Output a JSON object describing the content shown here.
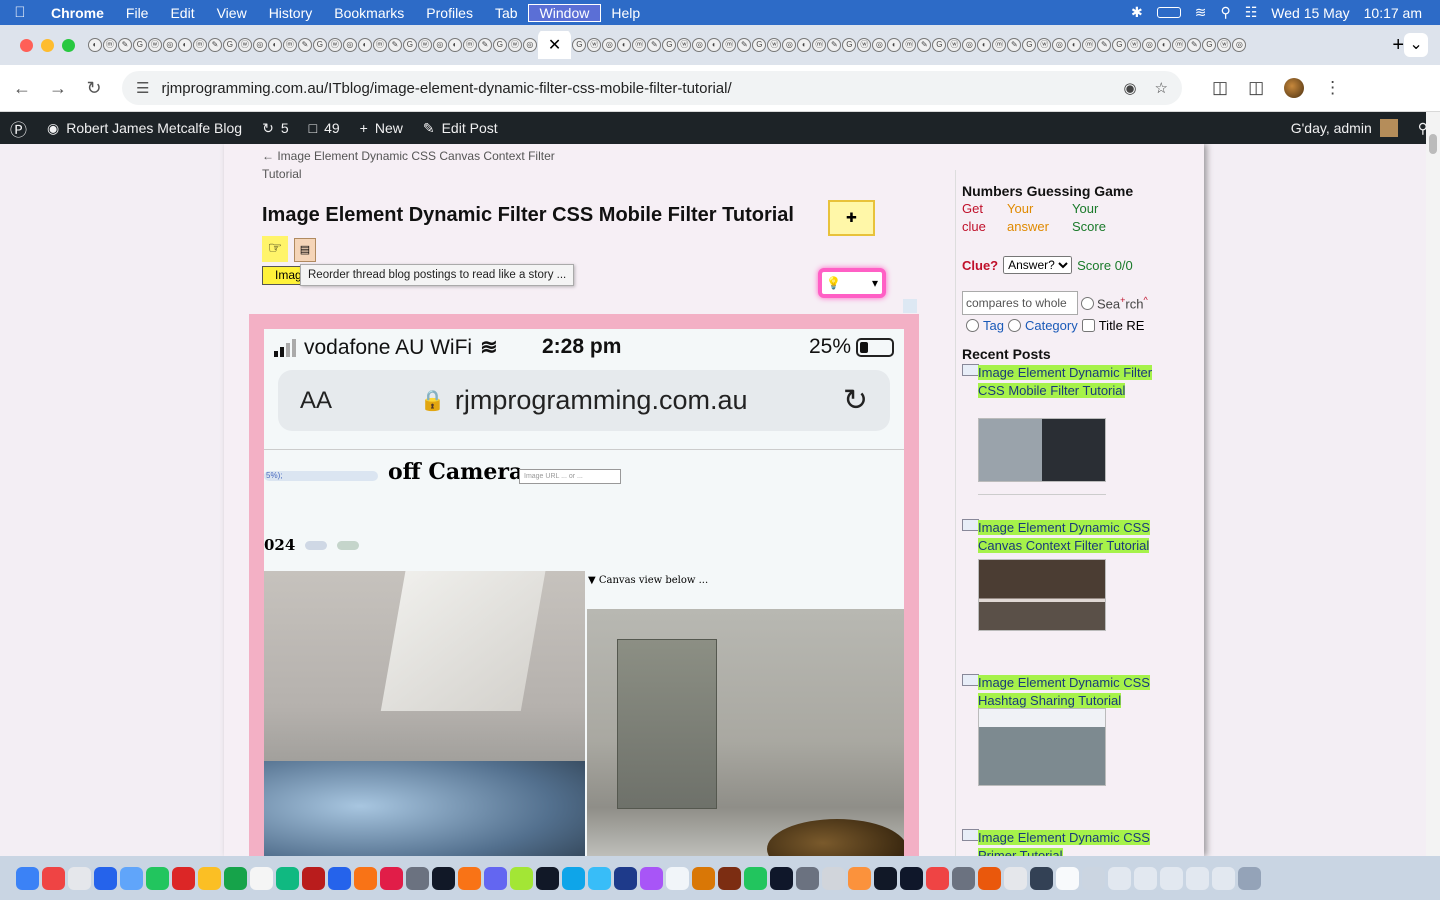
{
  "menubar": {
    "app": "Chrome",
    "items": [
      "File",
      "Edit",
      "View",
      "History",
      "Bookmarks",
      "Profiles",
      "Tab",
      "Window",
      "Help"
    ],
    "date": "Wed 15 May",
    "time": "10:17 am"
  },
  "browser": {
    "url": "rjmprogramming.com.au/ITblog/image-element-dynamic-filter-css-mobile-filter-tutorial/",
    "close_tab": "✕",
    "new_tab": "+"
  },
  "adminbar": {
    "site": "Robert James Metcalfe Blog",
    "updates": "5",
    "comments": "49",
    "new": "New",
    "edit": "Edit Post",
    "greeting": "G'day, admin"
  },
  "post": {
    "prev_link": "← Image Element Dynamic CSS Canvas Context Filter Tutorial",
    "title": "Image Element Dynamic Filter CSS Mobile Filter Tutorial",
    "yellow_box": "Imag",
    "tooltip": "Reorder thread blog postings to read like a story ..."
  },
  "phone": {
    "carrier": "vodafone AU WiFi",
    "time": "2:28 pm",
    "battery": "25%",
    "text_size": "AA",
    "domain": "rjmprogramming.com.au",
    "progress_text": "5%);",
    "heading": "off Camera",
    "url_placeholder": "Image URL ... or ...",
    "year": "024",
    "canvas_label": "▼ Canvas view below ..."
  },
  "sidebar": {
    "game_title": "Numbers Guessing Game",
    "col1": [
      "Get",
      "clue"
    ],
    "col2": [
      "Your",
      "answer"
    ],
    "col3": [
      "Your",
      "Score"
    ],
    "clue_label": "Clue?",
    "answer_option": "Answer?",
    "score": "Score 0/0",
    "search_value": "compares to whole",
    "search_label_a": "Sea",
    "search_label_b": "rch",
    "tag": "Tag",
    "category": "Category",
    "title_re": "Title RE",
    "recent_heading": "Recent Posts",
    "recent": [
      {
        "title": "Image Element Dynamic Filter CSS Mobile Filter Tutorial"
      },
      {
        "title": "Image Element Dynamic CSS Canvas Context Filter Tutorial"
      },
      {
        "title": "Image Element Dynamic CSS Hashtag Sharing Tutorial"
      },
      {
        "title": "Image Element Dynamic CSS Primer Tutorial"
      }
    ]
  },
  "colors": {
    "menubar_bg": "#2d6bc7",
    "admin_bg": "#1d2327",
    "highlight_green": "#a6f24a",
    "frame_pink": "#f3b0c5",
    "clue_red": "#c0102a"
  }
}
